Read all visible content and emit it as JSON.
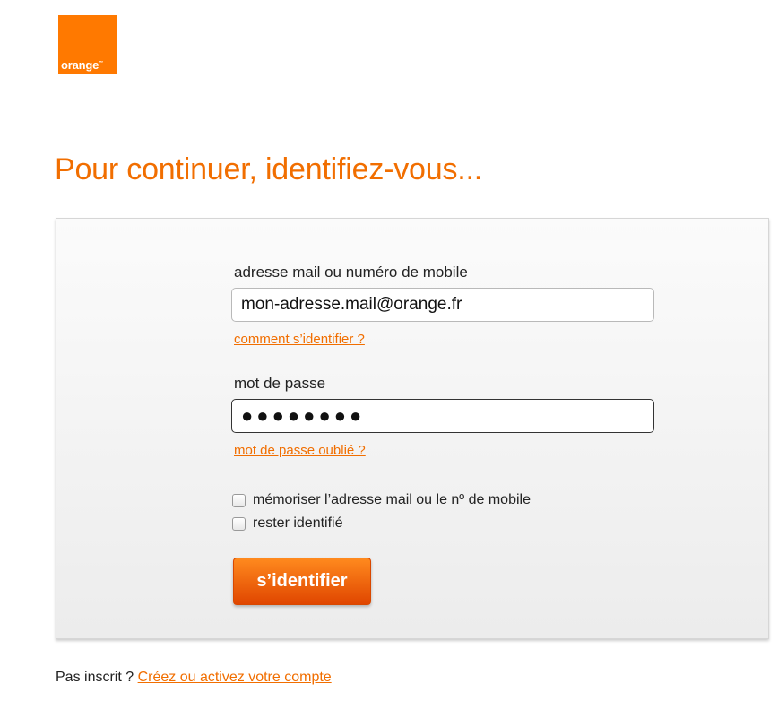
{
  "brand": {
    "logo_text": "orange",
    "color": "#ff7900"
  },
  "page": {
    "title": "Pour continuer, identifiez-vous..."
  },
  "form": {
    "login_label": "adresse mail ou numéro de mobile",
    "login_value": "mon-adresse.mail@orange.fr",
    "login_help": "comment s’identifier ?",
    "password_label": "mot de passe",
    "password_value": "●●●●●●●●",
    "password_help": "mot de passe oublié ?",
    "remember_label": "mémoriser l’adresse mail ou le nº de mobile",
    "stay_label": "rester identifié",
    "submit_label": "s’identifier"
  },
  "footer": {
    "text": "Pas inscrit ? ",
    "link": "Créez ou activez votre compte"
  },
  "colors": {
    "accent": "#f16e00",
    "button": "#e04600"
  }
}
